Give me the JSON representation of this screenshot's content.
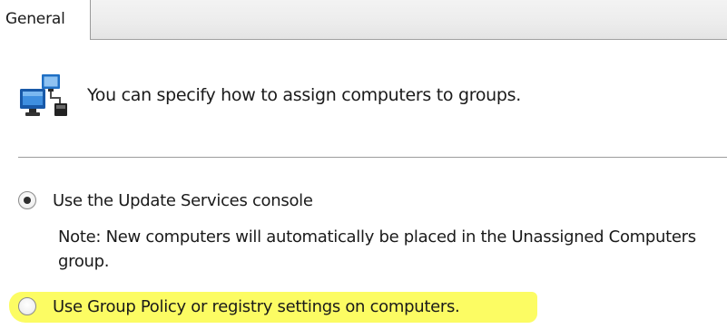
{
  "tabs": [
    {
      "label": "General",
      "active": true
    }
  ],
  "intro": {
    "icon": "computers-network-icon",
    "text": "You can specify how to assign computers to groups."
  },
  "options": [
    {
      "label": "Use the Update Services console",
      "selected": true,
      "note": "Note: New computers will automatically be placed in the Unassigned Computers group."
    },
    {
      "label": "Use Group Policy or registry settings on computers.",
      "selected": false,
      "highlighted": true
    }
  ],
  "colors": {
    "highlight": "#fbfb48",
    "tab_strip": "#ececec",
    "icon_blue": "#1e6fc4"
  }
}
